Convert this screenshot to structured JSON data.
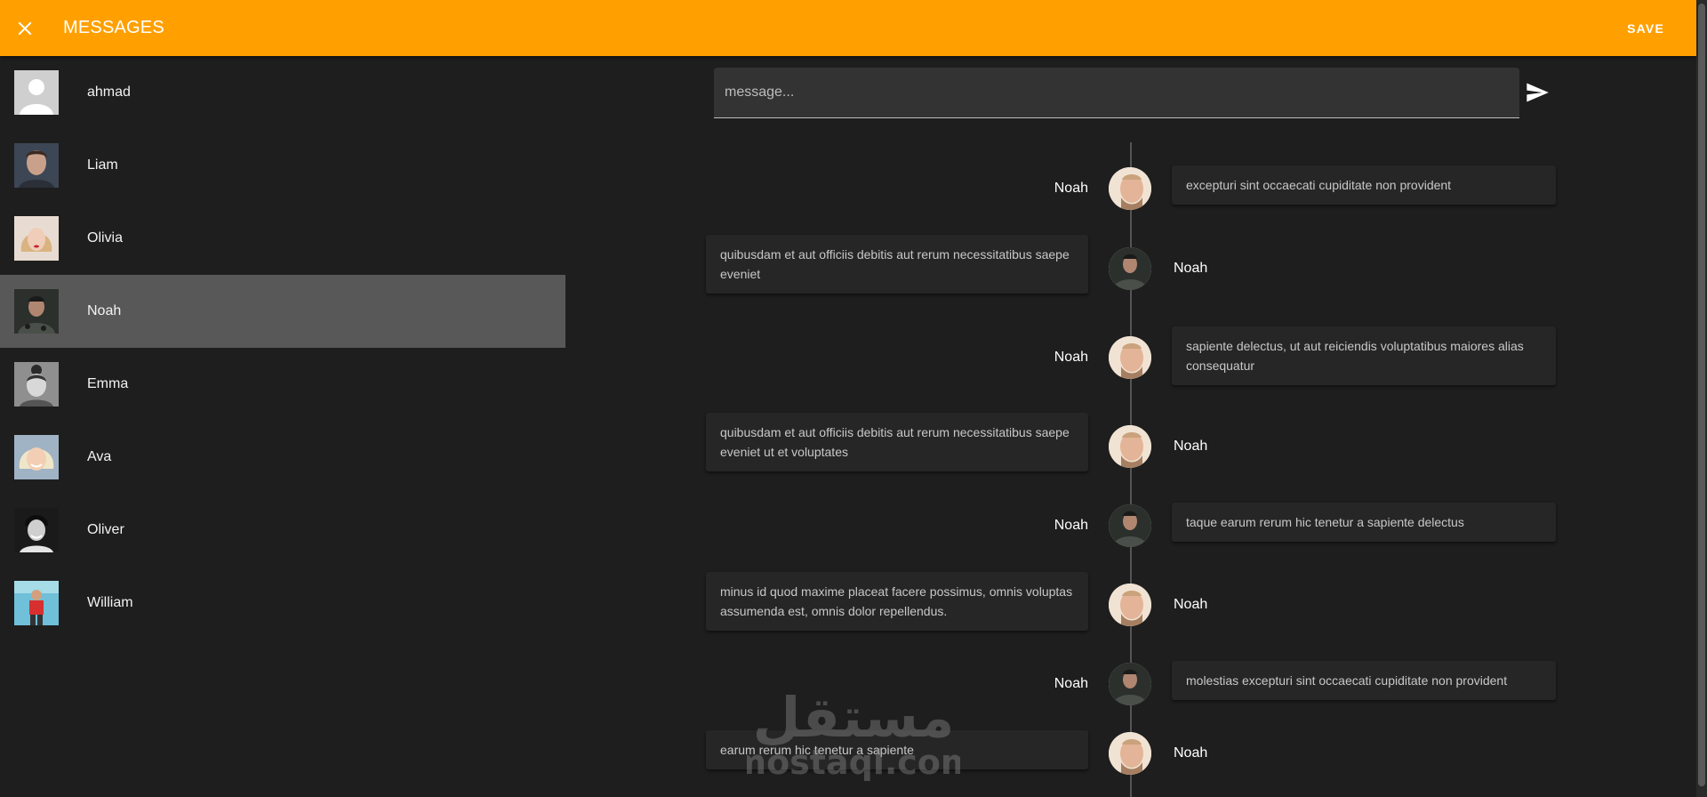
{
  "toolbar": {
    "title": "MESSAGES",
    "save_label": "SAVE",
    "background": "#ffa000"
  },
  "composer": {
    "placeholder": "message...",
    "send_icon": "send-icon"
  },
  "contacts": [
    {
      "name": "ahmad",
      "avatar": "default-avatar-icon",
      "selected": false
    },
    {
      "name": "Liam",
      "avatar": "photo",
      "selected": false
    },
    {
      "name": "Olivia",
      "avatar": "photo",
      "selected": false
    },
    {
      "name": "Noah",
      "avatar": "photo",
      "selected": true
    },
    {
      "name": "Emma",
      "avatar": "photo",
      "selected": false
    },
    {
      "name": "Ava",
      "avatar": "photo",
      "selected": false
    },
    {
      "name": "Oliver",
      "avatar": "photo",
      "selected": false
    },
    {
      "name": "William",
      "avatar": "photo",
      "selected": false
    }
  ],
  "messages": [
    {
      "sender": "Noah",
      "text": "excepturi sint occaecati cupiditate non provident",
      "side": "right",
      "avatar": "light"
    },
    {
      "sender": "Noah",
      "text": "quibusdam et aut officiis debitis aut rerum necessitatibus saepe eveniet",
      "side": "left",
      "avatar": "dark"
    },
    {
      "sender": "Noah",
      "text": "sapiente delectus, ut aut reiciendis voluptatibus maiores alias consequatur",
      "side": "right",
      "avatar": "light"
    },
    {
      "sender": "Noah",
      "text": "quibusdam et aut officiis debitis aut rerum necessitatibus saepe eveniet ut et voluptates",
      "side": "left",
      "avatar": "light"
    },
    {
      "sender": "Noah",
      "text": "taque earum rerum hic tenetur a sapiente delectus",
      "side": "right",
      "avatar": "dark"
    },
    {
      "sender": "Noah",
      "text": "minus id quod maxime placeat facere possimus, omnis voluptas assumenda est, omnis dolor repellendus.",
      "side": "left",
      "avatar": "light"
    },
    {
      "sender": "Noah",
      "text": "molestias excepturi sint occaecati cupiditate non provident",
      "side": "right",
      "avatar": "dark"
    },
    {
      "sender": "Noah",
      "text": "earum rerum hic tenetur a sapiente",
      "side": "left",
      "avatar": "light"
    }
  ],
  "watermark": {
    "arabic": "مستقل",
    "latin": "mostaql.com"
  }
}
